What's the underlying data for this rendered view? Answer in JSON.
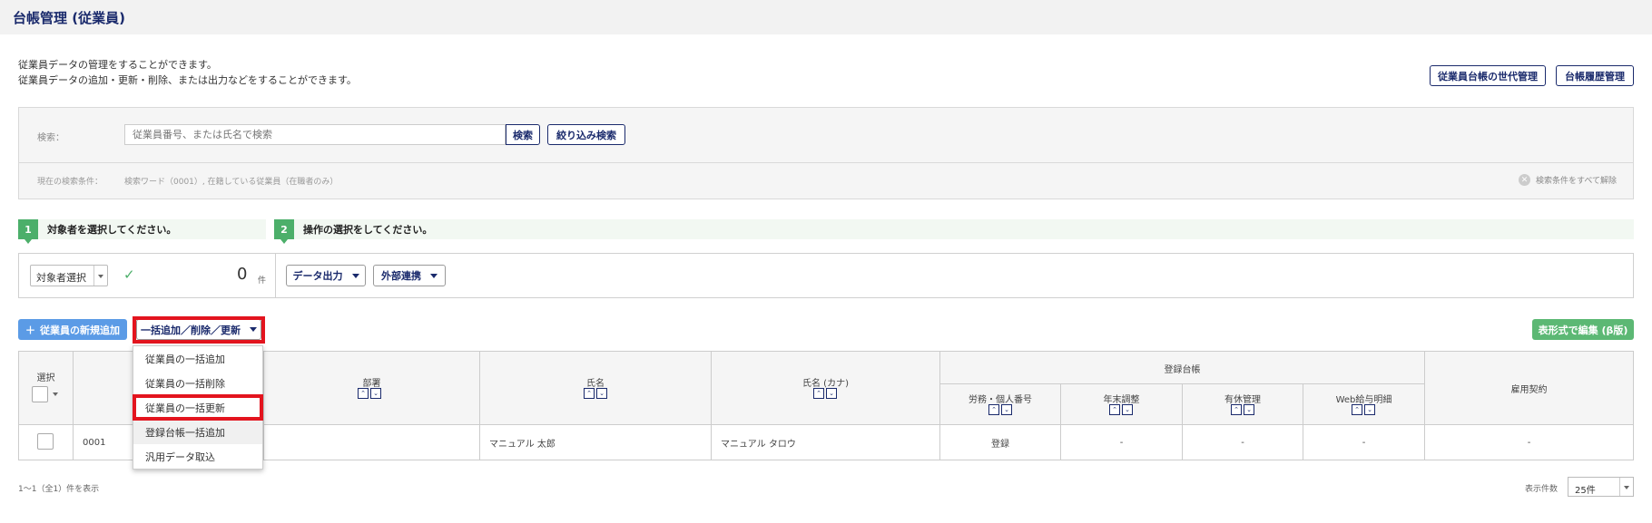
{
  "page_title": "台帳管理 (従業員)",
  "description": [
    "従業員データの管理をすることができます。",
    "従業員データの追加・更新・削除、または出力などをすることができます。"
  ],
  "top_buttons": {
    "generation": "従業員台帳の世代管理",
    "history": "台帳履歴管理"
  },
  "search": {
    "label": "検索：",
    "placeholder": "従業員番号、または氏名で検索",
    "search_button": "検索",
    "filter_button": "絞り込み検索",
    "condition_label": "現在の検索条件：",
    "condition_value": "検索ワード（0001）, 在籍している従業員（在職者のみ）",
    "clear_all": "検索条件をすべて解除"
  },
  "steps": [
    {
      "num": "1",
      "label": "対象者を選択してください。"
    },
    {
      "num": "2",
      "label": "操作の選択をしてください。"
    }
  ],
  "operation": {
    "target_select": "対象者選択",
    "count": "0",
    "count_unit": "件",
    "data_output": "データ出力",
    "external": "外部連携"
  },
  "actions": {
    "add_employee": "従業員の新規追加",
    "bulk": "一括追加／削除／更新",
    "table_edit": "表形式で編集 (β版)"
  },
  "dropdown_items": [
    "従業員の一括追加",
    "従業員の一括削除",
    "従業員の一括更新",
    "登録台帳一括追加",
    "汎用データ取込"
  ],
  "table": {
    "headers": {
      "select": "選択",
      "dept": "部署",
      "name": "氏名",
      "kana": "氏名 (カナ)",
      "registered_group": "登録台帳",
      "labor": "労務・個人番号",
      "yearend": "年末調整",
      "leave": "有休管理",
      "web_payslip": "Web給与明細",
      "contract": "雇用契約"
    },
    "row": {
      "id": "0001",
      "name": "マニュアル 太郎",
      "kana": "マニュアル タロウ",
      "labor": "登録",
      "yearend": "-",
      "leave": "-",
      "web_payslip": "-",
      "contract": "-"
    }
  },
  "footer": {
    "summary": "1～1（全1）件を表示",
    "per_page_label": "表示件数",
    "per_page_value": "25件"
  },
  "colors": {
    "navy": "#1a2a6c",
    "green": "#5cb874",
    "blue": "#5b9be6",
    "highlight": "#e3141e"
  }
}
